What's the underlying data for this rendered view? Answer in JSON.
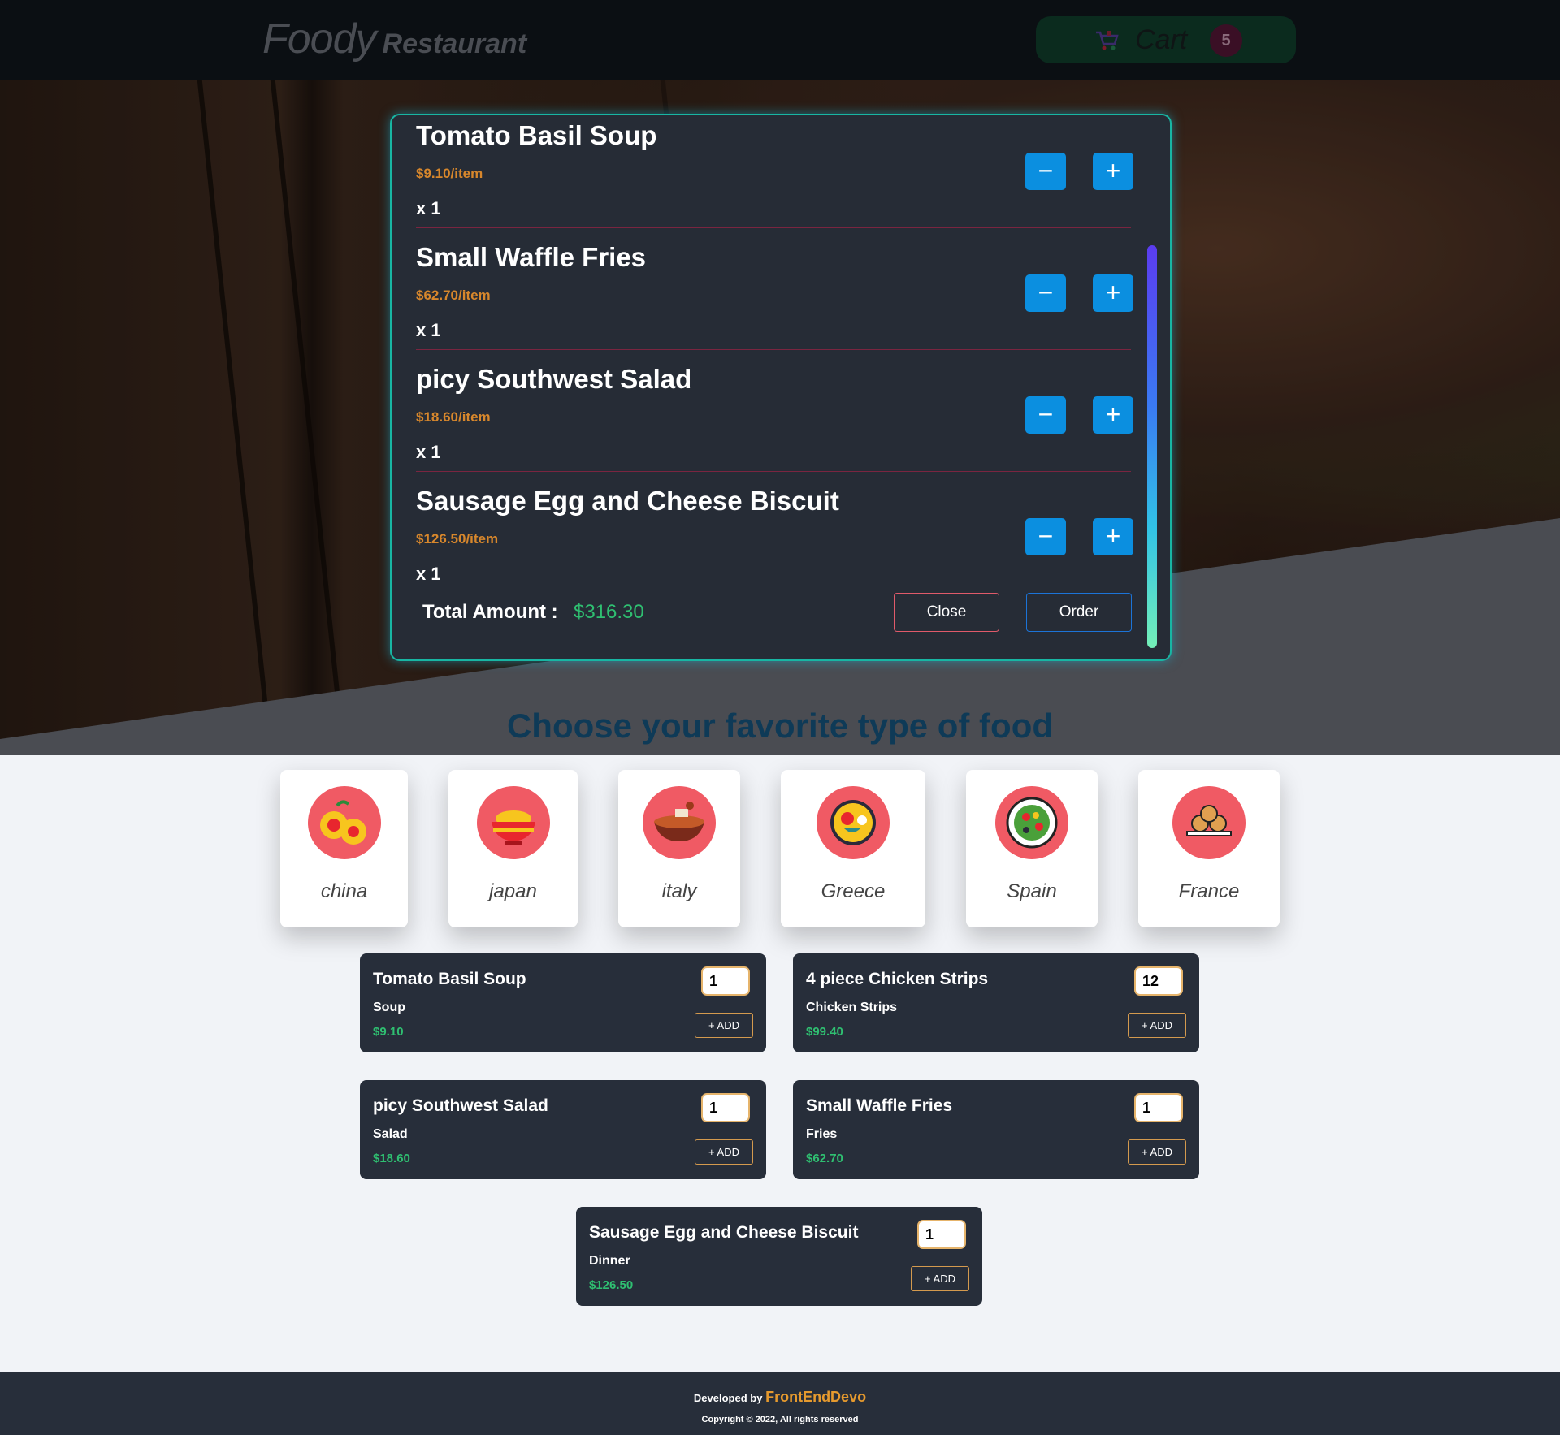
{
  "header": {
    "brand_main": "Foody",
    "brand_sub": "Restaurant",
    "cart_label": "Cart",
    "cart_count": "5"
  },
  "modal": {
    "items": [
      {
        "name": "Tomato Basil Soup",
        "price": "$9.10/item",
        "qty": "x 1"
      },
      {
        "name": "Small Waffle Fries",
        "price": "$62.70/item",
        "qty": "x 1"
      },
      {
        "name": "picy Southwest Salad",
        "price": "$18.60/item",
        "qty": "x 1"
      },
      {
        "name": "Sausage Egg and Cheese Biscuit",
        "price": "$126.50/item",
        "qty": "x 1"
      }
    ],
    "minus_symbol": "−",
    "plus_symbol": "+",
    "total_label": "Total Amount :",
    "total_value": "$316.30",
    "close_label": "Close",
    "order_label": "Order"
  },
  "section": {
    "title": "Choose your favorite type of food"
  },
  "categories": [
    {
      "label": "china",
      "icon": "oranges-icon"
    },
    {
      "label": "japan",
      "icon": "noodle-bowl-icon"
    },
    {
      "label": "italy",
      "icon": "pasta-bowl-icon"
    },
    {
      "label": "Greece",
      "icon": "paella-pan-icon"
    },
    {
      "label": "Spain",
      "icon": "salad-plate-icon"
    },
    {
      "label": "France",
      "icon": "pastries-icon"
    }
  ],
  "foods": [
    {
      "name": "Tomato Basil Soup",
      "category": "Soup",
      "price": "$9.10",
      "qty": "1",
      "add": "+ ADD"
    },
    {
      "name": "4 piece Chicken Strips",
      "category": "Chicken Strips",
      "price": "$99.40",
      "qty": "12",
      "add": "+ ADD"
    },
    {
      "name": "picy Southwest Salad",
      "category": "Salad",
      "price": "$18.60",
      "qty": "1",
      "add": "+ ADD"
    },
    {
      "name": "Small Waffle Fries",
      "category": "Fries",
      "price": "$62.70",
      "qty": "1",
      "add": "+ ADD"
    },
    {
      "name": "Sausage Egg and Cheese Biscuit",
      "category": "Dinner",
      "price": "$126.50",
      "qty": "1",
      "add": "+ ADD"
    }
  ],
  "footer": {
    "developed_by": "Developed by",
    "developer": "FrontEndDevo",
    "copyright": "Copyright © 2022, All rights reserved"
  },
  "colors": {
    "accent_green": "#2fbf71",
    "price_orange": "#d7872c",
    "button_blue": "#0b8fe0",
    "card_dark": "#272e3a",
    "category_icon_bg": "#f05a64",
    "heading_blue": "#0e3a57"
  }
}
